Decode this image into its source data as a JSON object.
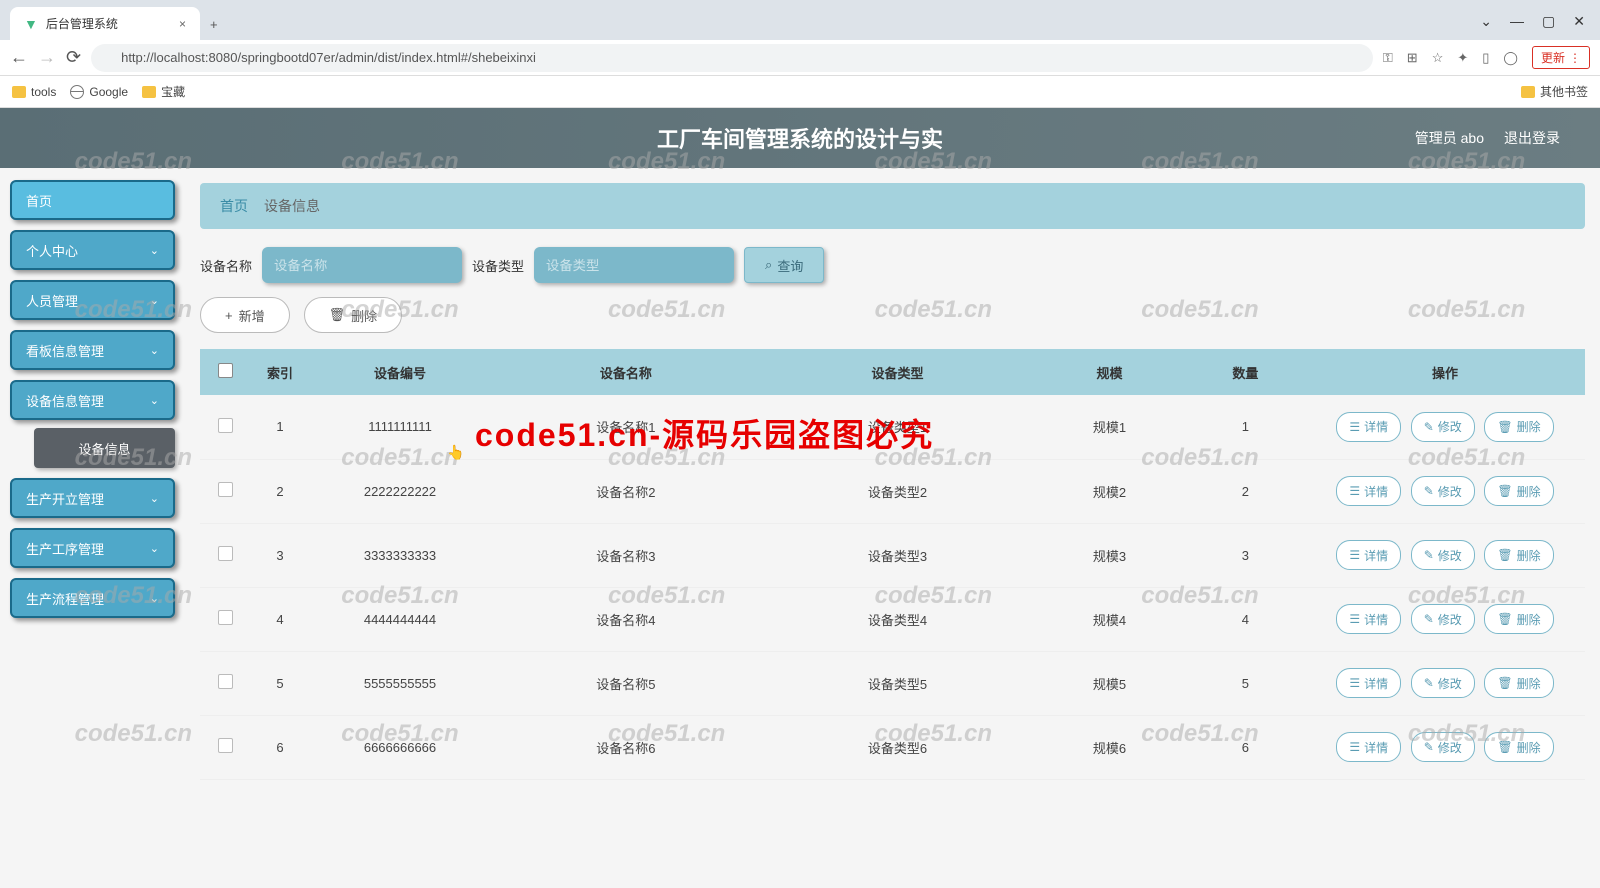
{
  "browser": {
    "tab_title": "后台管理系统",
    "url": "http://localhost:8080/springbootd07er/admin/dist/index.html#/shebeixinxi",
    "update_label": "更新",
    "bookmarks": [
      "tools",
      "Google",
      "宝藏"
    ],
    "other_bookmarks": "其他书签"
  },
  "header": {
    "title": "工厂车间管理系统的设计与实",
    "user": "管理员 abo",
    "logout": "退出登录"
  },
  "sidebar": {
    "items": [
      {
        "label": "首页",
        "expandable": false
      },
      {
        "label": "个人中心",
        "expandable": true
      },
      {
        "label": "人员管理",
        "expandable": true
      },
      {
        "label": "看板信息管理",
        "expandable": true
      },
      {
        "label": "设备信息管理",
        "expandable": true,
        "active": true
      },
      {
        "label": "生产开立管理",
        "expandable": true
      },
      {
        "label": "生产工序管理",
        "expandable": true
      },
      {
        "label": "生产流程管理",
        "expandable": true
      }
    ],
    "submenu_active": "设备信息"
  },
  "breadcrumb": {
    "home": "首页",
    "current": "设备信息"
  },
  "filter": {
    "name_label": "设备名称",
    "name_placeholder": "设备名称",
    "type_label": "设备类型",
    "type_placeholder": "设备类型",
    "search_btn": "查询"
  },
  "actions": {
    "add": "新增",
    "delete": "删除"
  },
  "table": {
    "headers": [
      "索引",
      "设备编号",
      "设备名称",
      "设备类型",
      "规模",
      "数量",
      "操作"
    ],
    "row_btns": {
      "detail": "详情",
      "edit": "修改",
      "delete": "删除"
    },
    "rows": [
      {
        "idx": "1",
        "code": "1111111111",
        "name": "设备名称1",
        "type": "设备类型1",
        "scale": "规模1",
        "qty": "1"
      },
      {
        "idx": "2",
        "code": "2222222222",
        "name": "设备名称2",
        "type": "设备类型2",
        "scale": "规模2",
        "qty": "2"
      },
      {
        "idx": "3",
        "code": "3333333333",
        "name": "设备名称3",
        "type": "设备类型3",
        "scale": "规模3",
        "qty": "3"
      },
      {
        "idx": "4",
        "code": "4444444444",
        "name": "设备名称4",
        "type": "设备类型4",
        "scale": "规模4",
        "qty": "4"
      },
      {
        "idx": "5",
        "code": "5555555555",
        "name": "设备名称5",
        "type": "设备类型5",
        "scale": "规模5",
        "qty": "5"
      },
      {
        "idx": "6",
        "code": "6666666666",
        "name": "设备名称6",
        "type": "设备类型6",
        "scale": "规模6",
        "qty": "6"
      }
    ]
  },
  "watermark": {
    "text": "code51.cn",
    "red_text": "code51.cn-源码乐园盗图必究"
  }
}
